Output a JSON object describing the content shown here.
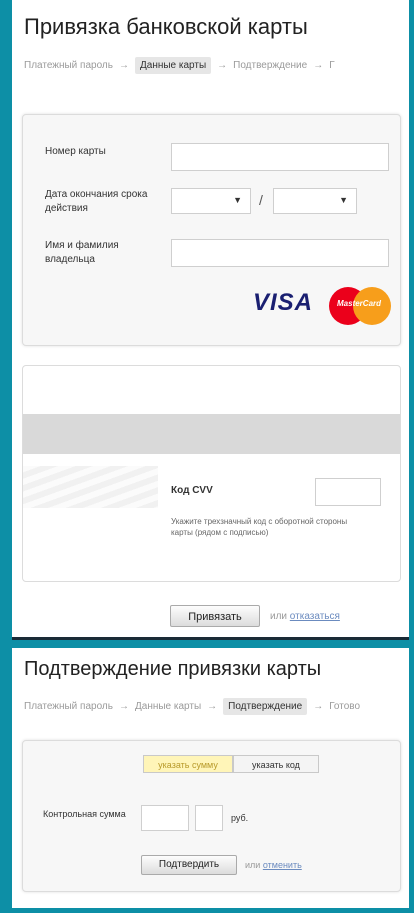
{
  "panel1": {
    "title": "Привязка банковской карты",
    "breadcrumbs": [
      {
        "label": "Платежный пароль"
      },
      {
        "label": "Данные карты"
      },
      {
        "label": "Подтверждение"
      },
      {
        "label": "Г"
      }
    ],
    "arrow": "→",
    "form": {
      "card_number_label": "Номер карты",
      "expiry_label": "Дата окончания срока действия",
      "slash": "/",
      "owner_label": "Имя и фамилия владельца",
      "visa": "VISA",
      "mastercard": "MasterCard"
    },
    "cvv": {
      "label": "Код CVV",
      "hint": "Укажите трехзначный код с оборотной стороны карты (рядом с подписью)"
    },
    "submit_label": "Привязать",
    "or_label": "или",
    "cancel_label": "отказаться"
  },
  "panel2": {
    "title": "Подтверждение привязки карты",
    "breadcrumbs": [
      {
        "label": "Платежный пароль"
      },
      {
        "label": "Данные карты"
      },
      {
        "label": "Подтверждение"
      },
      {
        "label": "Готово"
      }
    ],
    "arrow": "→",
    "toggle": {
      "sum_label": "указать сумму",
      "code_label": "указать код"
    },
    "control_sum_label": "Контрольная сумма",
    "currency": "руб.",
    "confirm_label": "Подтвердить",
    "or_label": "или",
    "cancel_label": "отменить"
  }
}
